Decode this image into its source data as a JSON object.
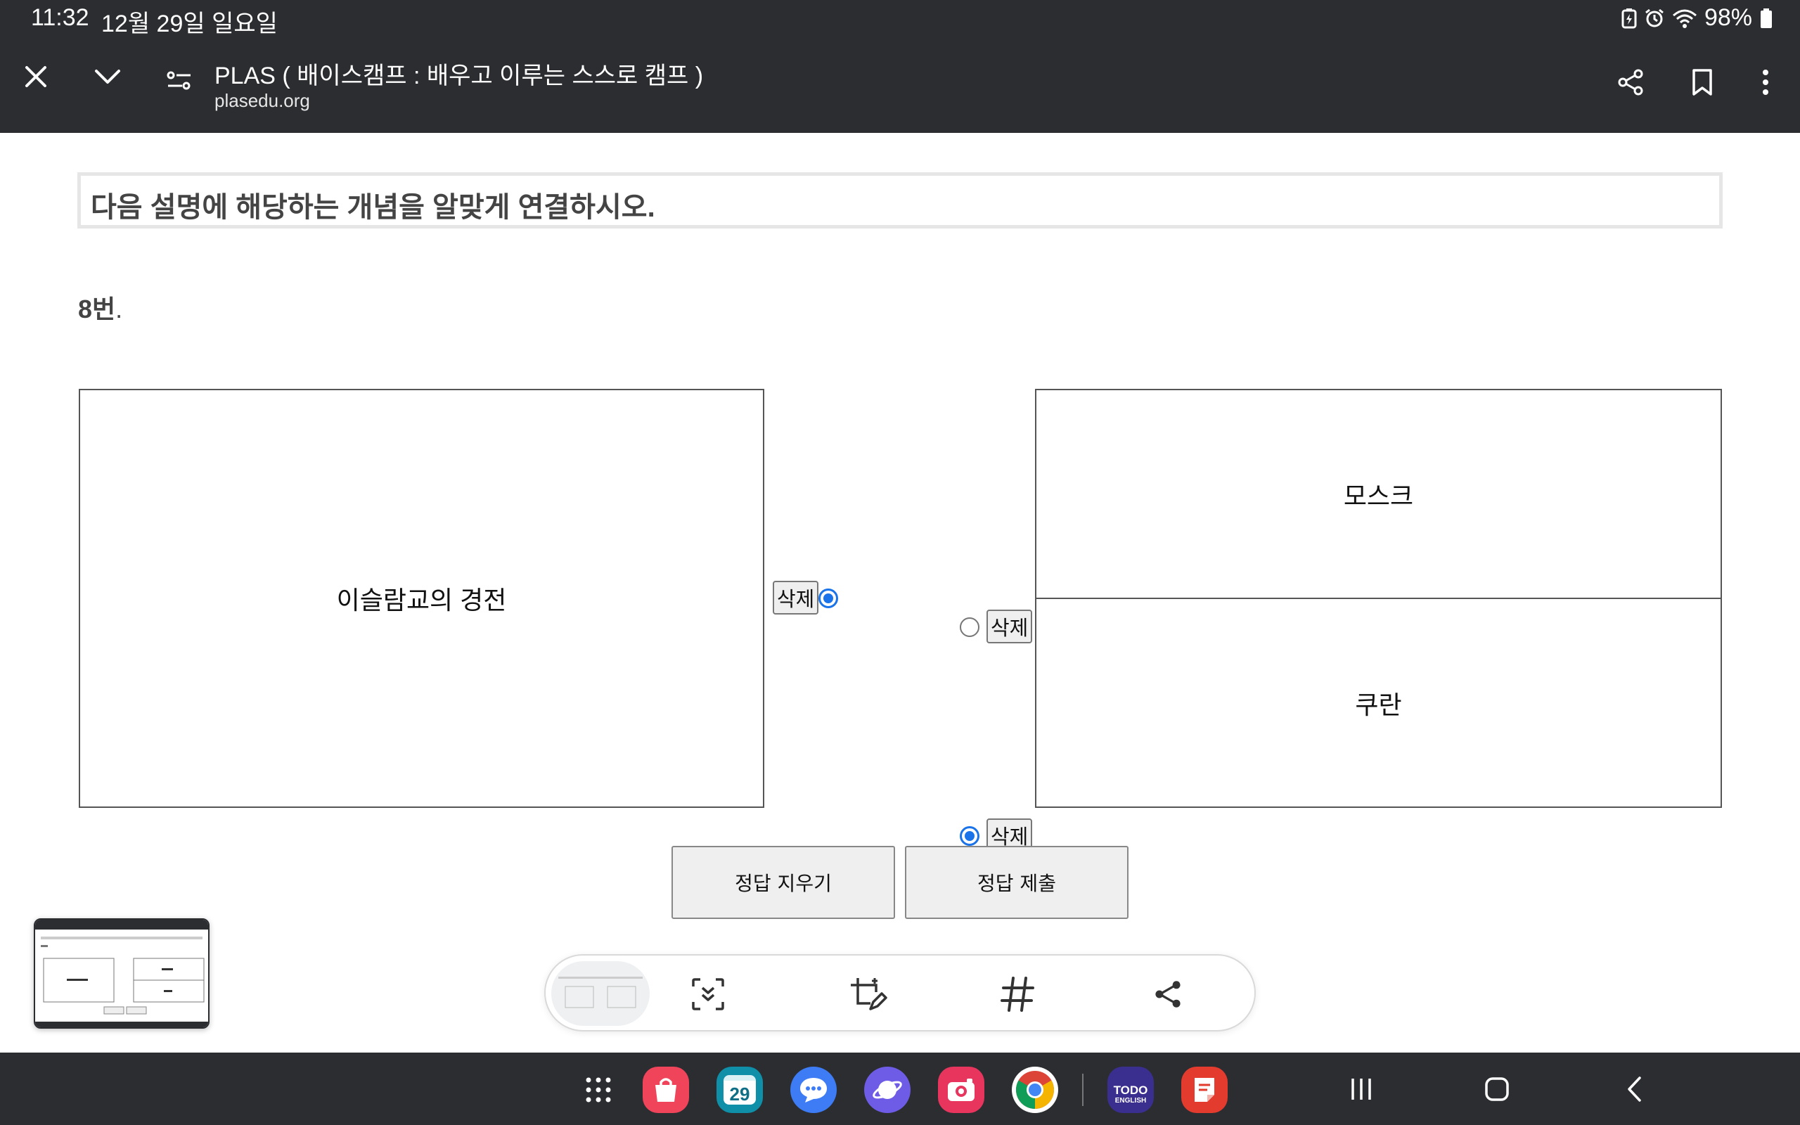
{
  "status_bar": {
    "time": "11:32",
    "date": "12월 29일 일요일",
    "battery": "98%"
  },
  "browser": {
    "title": "PLAS ( 배이스캠프 : 배우고 이루는 스스로 캠프 )",
    "domain": "plasedu.org"
  },
  "quiz": {
    "instruction": "다음 설명에 해당하는 개념을 알맞게 연결하시오.",
    "question_number": "8번",
    "question_dot": ".",
    "left_item": "이슬람교의 경전",
    "right_items": [
      "모스크",
      "쿠란"
    ],
    "delete_label": "삭제",
    "left_radio_checked": true,
    "right_radio_checked": [
      false,
      true
    ]
  },
  "actions": {
    "clear_label": "정답 지우기",
    "submit_label": "정답 제출"
  },
  "taskbar": {
    "calendar_day": "29",
    "todo_label_1": "TODO",
    "todo_label_2": "ENGLISH"
  },
  "colors": {
    "bar_bg": "#2b2d31",
    "accent": "#1a73e8",
    "question_border": "#e6e6e6"
  }
}
